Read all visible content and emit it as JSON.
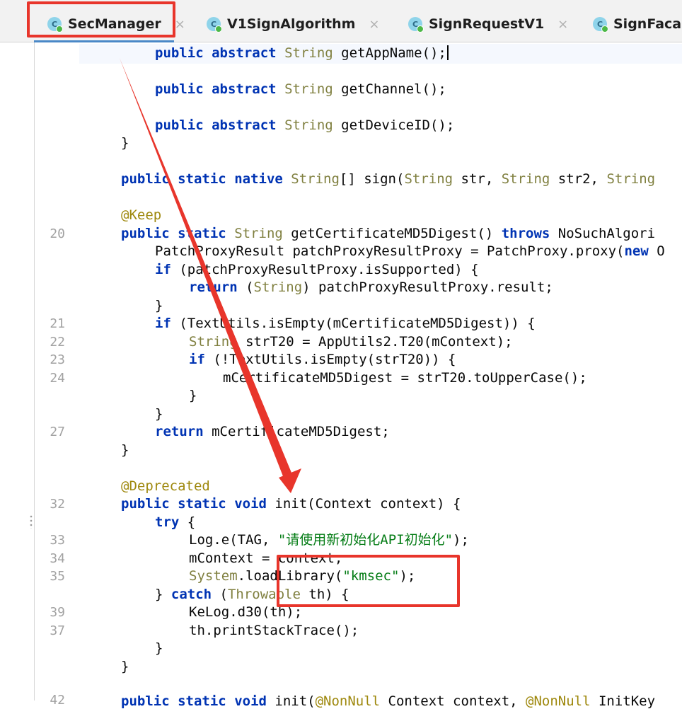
{
  "tabs": [
    {
      "label": "SecManager",
      "active": true,
      "icon": "class-icon",
      "close": "×"
    },
    {
      "label": "V1SignAlgorithm",
      "active": false,
      "icon": "class-icon",
      "close": "×"
    },
    {
      "label": "SignRequestV1",
      "active": false,
      "icon": "class-icon",
      "close": "×"
    },
    {
      "label": "SignFaca",
      "active": false,
      "icon": "class-icon",
      "close": ""
    }
  ],
  "class_icon_letter": "C",
  "line_numbers": [
    "20",
    "21",
    "22",
    "23",
    "24",
    "27",
    "32",
    "33",
    "34",
    "35",
    "39",
    "37",
    "42"
  ],
  "code_lines": [
    "public abstract String getAppName();",
    "public abstract String getChannel();",
    "public abstract String getDeviceID();",
    "}",
    "public static native String[] sign(String str, String str2, String",
    "@Keep",
    "public static String getCertificateMD5Digest() throws NoSuchAlgori",
    "PatchProxyResult patchProxyResultProxy = PatchProxy.proxy(new O",
    "if (patchProxyResultProxy.isSupported) {",
    "return (String) patchProxyResultProxy.result;",
    "}",
    "if (TextUtils.isEmpty(mCertificateMD5Digest)) {",
    "String strT20 = AppUtils2.T20(mContext);",
    "if (!TextUtils.isEmpty(strT20)) {",
    "mCertificateMD5Digest = strT20.toUpperCase();",
    "}",
    "}",
    "return mCertificateMD5Digest;",
    "}",
    "@Deprecated",
    "public static void init(Context context) {",
    "try {",
    "Log.e(TAG, \"请使用新初始化API初始化\");",
    "mContext = context;",
    "System.loadLibrary(\"kmsec\");",
    "} catch (Throwable th) {",
    "KeLog.d30(th);",
    "th.printStackTrace();",
    "}",
    "}",
    "public static void init(@NonNull Context context, @NonNull InitKey"
  ],
  "colors": {
    "keyword": "#0033b3",
    "type": "#808040",
    "annotation": "#9e880d",
    "string": "#067d17",
    "highlight_red": "#e8352b",
    "active_tab_underline": "#4a88c7"
  }
}
